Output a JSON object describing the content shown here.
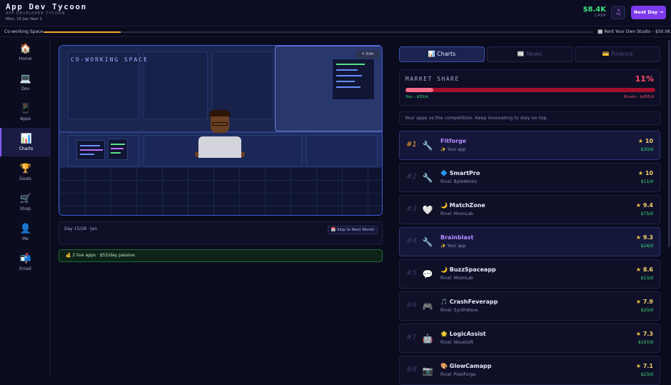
{
  "header": {
    "title": "App Dev Tycoon",
    "subtitle": "APP DEVELOPER TYCOON",
    "date": "Mon, 15 Jan Year 1",
    "cash_value": "$8.4K",
    "cash_label": "CASH",
    "music_icon": "♫",
    "next_day_label": "Next Day →"
  },
  "progress": {
    "left_label": "Co-working Space",
    "right_label": "Rent Your Own Studio – $50.0K",
    "fraction": 0.14
  },
  "sidebar": {
    "items": [
      {
        "label": "Home",
        "icon": "house-icon",
        "glyph": "🏠"
      },
      {
        "label": "Dev",
        "icon": "laptop-icon",
        "glyph": "💻"
      },
      {
        "label": "Apps",
        "icon": "phone-icon",
        "glyph": "📱"
      },
      {
        "label": "Charts",
        "icon": "chart-icon",
        "glyph": "📊"
      },
      {
        "label": "Goals",
        "icon": "trophy-icon",
        "glyph": "🏆"
      },
      {
        "label": "Shop",
        "icon": "cart-icon",
        "glyph": "🛒"
      },
      {
        "label": "Me",
        "icon": "person-icon",
        "glyph": "👤"
      },
      {
        "label": "Email",
        "icon": "mailbox-icon",
        "glyph": "📬"
      }
    ],
    "active": "Charts"
  },
  "scene": {
    "label": "CO-WORKING SPACE",
    "edit_label": "Edit"
  },
  "day": {
    "text": "Day 15/28 · Jan",
    "skip_label": "Skip to Next Month"
  },
  "passive": {
    "text": "💰 2 live apps · $55/day passive"
  },
  "tabs": [
    {
      "label": "Charts",
      "icon": "chart-icon"
    },
    {
      "label": "News",
      "icon": "newspaper-icon"
    },
    {
      "label": "Finance",
      "icon": "card-icon"
    }
  ],
  "market": {
    "title": "MARKET SHARE",
    "percent_label": "11%",
    "share": 0.11,
    "you_label": "You – $55/d",
    "rivals_label": "Rivals – $455/d"
  },
  "note": "Your apps vs the competition. Keep innovating to stay on top.",
  "rankings": [
    {
      "rank": "#1",
      "name": "Fitforge",
      "badge": "",
      "owner": "✨ Your app",
      "score": "10",
      "revenue": "$30/d",
      "mine": true,
      "icon": "wrench-icon",
      "glyph": "🔧"
    },
    {
      "rank": "#2",
      "name": "SmartPro",
      "badge": "🔷",
      "owner": "Rival: ByteWorks",
      "score": "10",
      "revenue": "$11/d",
      "mine": false,
      "icon": "wrench-icon",
      "glyph": "🔧"
    },
    {
      "rank": "#3",
      "name": "MatchZone",
      "badge": "🌙",
      "owner": "Rival: MoonLab",
      "score": "9.4",
      "revenue": "$75/d",
      "mine": false,
      "icon": "heart-icon",
      "glyph": "🤍"
    },
    {
      "rank": "#4",
      "name": "Brainblast",
      "badge": "",
      "owner": "✨ Your app",
      "score": "9.3",
      "revenue": "$24/d",
      "mine": true,
      "icon": "wrench-icon",
      "glyph": "🔧"
    },
    {
      "rank": "#5",
      "name": "BuzzSpaceapp",
      "badge": "🌙",
      "owner": "Rival: MoonLab",
      "score": "8.6",
      "revenue": "$13/d",
      "mine": false,
      "icon": "speech-bubble-icon",
      "glyph": "💬"
    },
    {
      "rank": "#6",
      "name": "CrashFeverapp",
      "badge": "🎵",
      "owner": "Rival: SynthWave",
      "score": "7.9",
      "revenue": "$20/d",
      "mine": false,
      "icon": "gamepad-icon",
      "glyph": "🎮"
    },
    {
      "rank": "#7",
      "name": "LogicAssist",
      "badge": "🌟",
      "owner": "Rival: NovaSoft",
      "score": "7.3",
      "revenue": "$107/d",
      "mine": false,
      "icon": "robot-icon",
      "glyph": "🤖"
    },
    {
      "rank": "#8",
      "name": "GlowCamapp",
      "badge": "🎨",
      "owner": "Rival: PixelForge",
      "score": "7.1",
      "revenue": "$23/d",
      "mine": false,
      "icon": "camera-icon",
      "glyph": "📷"
    }
  ]
}
